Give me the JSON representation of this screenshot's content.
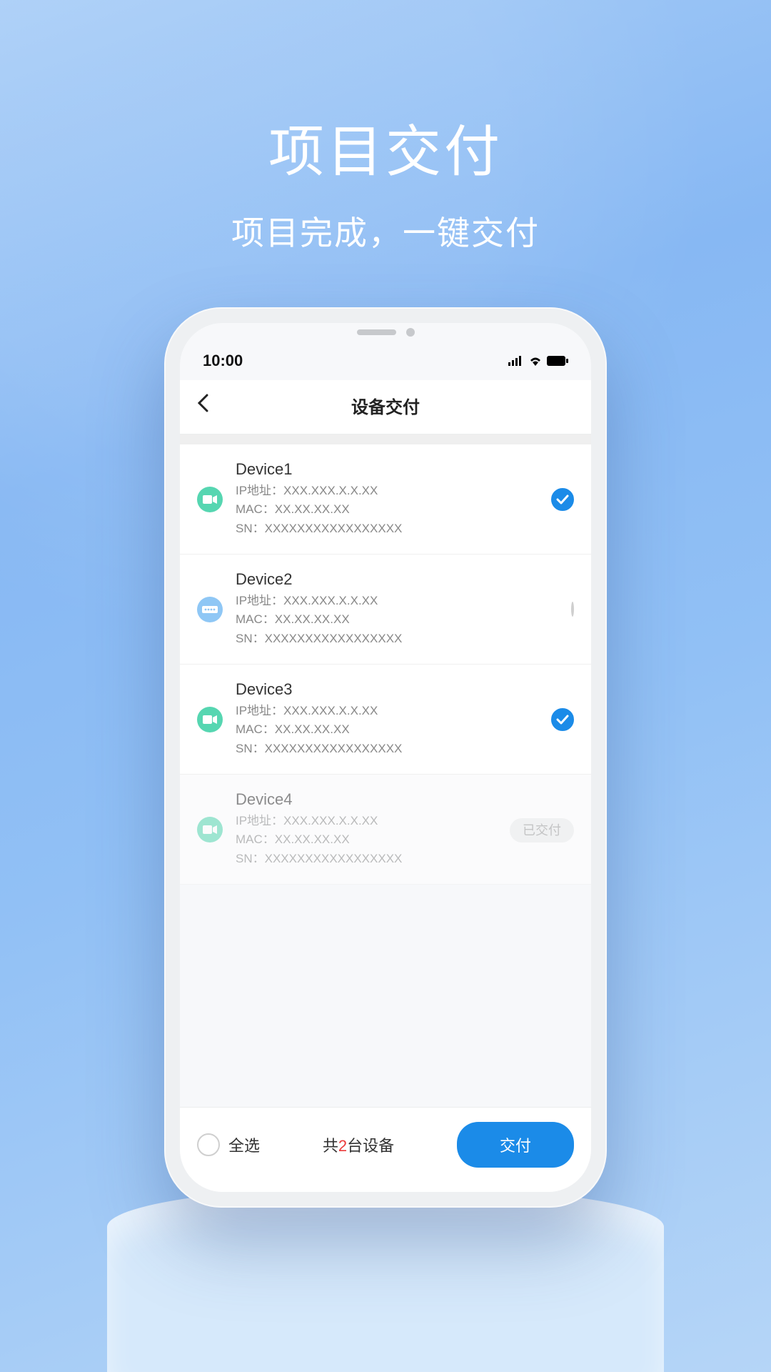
{
  "hero": {
    "title": "项目交付",
    "subtitle": "项目完成，一键交付"
  },
  "status": {
    "time": "10:00"
  },
  "nav": {
    "title": "设备交付"
  },
  "devices": [
    {
      "name": "Device1",
      "ip": "IP地址：XXX.XXX.X.X.XX",
      "mac": "MAC：XX.XX.XX.XX",
      "sn": "SN：XXXXXXXXXXXXXXXXX",
      "icon": "camera",
      "state": "checked"
    },
    {
      "name": "Device2",
      "ip": "IP地址：XXX.XXX.X.X.XX",
      "mac": "MAC：XX.XX.XX.XX",
      "sn": "SN：XXXXXXXXXXXXXXXXX",
      "icon": "nvr",
      "state": "unchecked"
    },
    {
      "name": "Device3",
      "ip": "IP地址：XXX.XXX.X.X.XX",
      "mac": "MAC：XX.XX.XX.XX",
      "sn": "SN：XXXXXXXXXXXXXXXXX",
      "icon": "camera",
      "state": "checked"
    },
    {
      "name": "Device4",
      "ip": "IP地址：XXX.XXX.X.X.XX",
      "mac": "MAC：XX.XX.XX.XX",
      "sn": "SN：XXXXXXXXXXXXXXXXX",
      "icon": "camera",
      "state": "delivered"
    }
  ],
  "footer": {
    "select_all": "全选",
    "total_prefix": "共",
    "total_count": "2",
    "total_suffix": "台设备",
    "submit": "交付",
    "delivered_badge": "已交付"
  },
  "colors": {
    "primary": "#1b8be8",
    "danger": "#eb3b3b"
  }
}
